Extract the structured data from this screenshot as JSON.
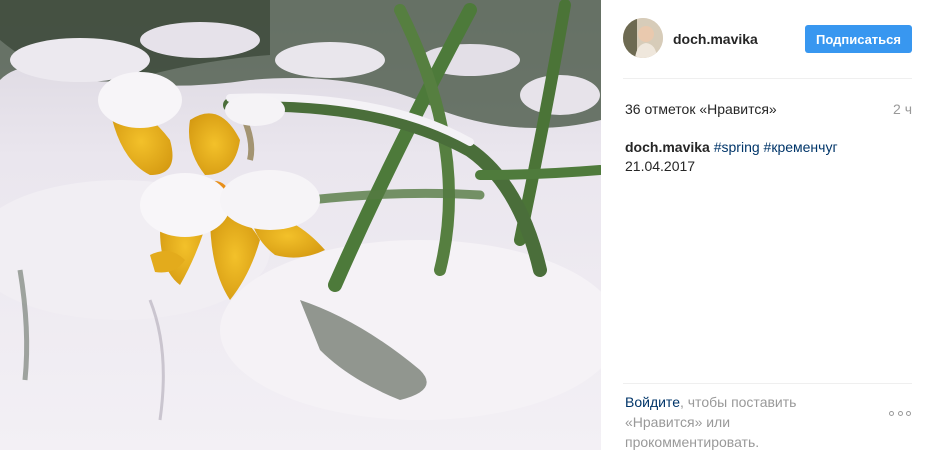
{
  "post": {
    "image_alt": "Snow-covered yellow daffodil with green leaves",
    "author": {
      "username": "doch.mavika"
    },
    "follow_label": "Подписаться",
    "likes_text": "36 отметок «Нравится»",
    "time_ago": "2 ч",
    "caption": {
      "username": "doch.mavika",
      "hashtags": [
        "#spring",
        "#кременчуг"
      ],
      "text": "21.04.2017"
    },
    "login_prompt": {
      "link": "Войдите",
      "rest": ", чтобы поставить «Нравится» или прокомментировать."
    }
  },
  "colors": {
    "accent": "#3897f0",
    "link": "#003569",
    "muted": "#999999",
    "text": "#262626"
  }
}
